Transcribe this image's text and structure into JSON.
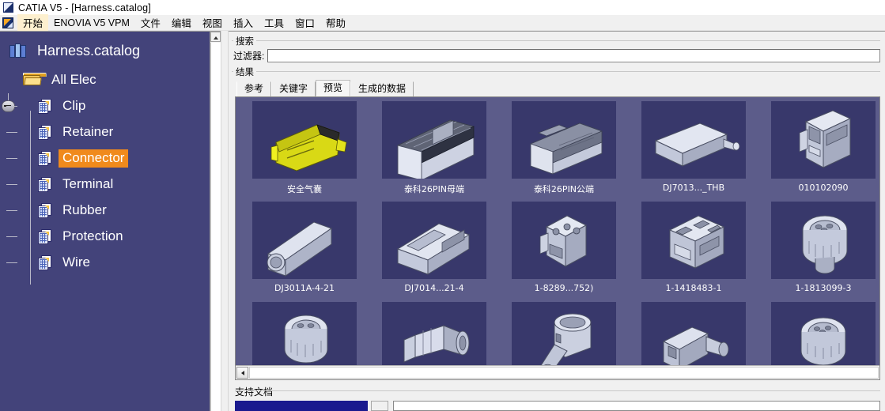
{
  "window": {
    "title": "CATIA V5 - [Harness.catalog]",
    "app_icon": "catia-logo-icon"
  },
  "menubar": {
    "start_icon": "catia-start-icon",
    "items": [
      {
        "label": "开始",
        "active": true
      },
      {
        "label": "ENOVIA V5 VPM",
        "active": false
      },
      {
        "label": "文件",
        "active": false
      },
      {
        "label": "编辑",
        "active": false
      },
      {
        "label": "视图",
        "active": false
      },
      {
        "label": "插入",
        "active": false
      },
      {
        "label": "工具",
        "active": false
      },
      {
        "label": "窗口",
        "active": false
      },
      {
        "label": "帮助",
        "active": false
      }
    ]
  },
  "tree": {
    "root": {
      "label": "Harness.catalog",
      "icon": "catalog-icon"
    },
    "folder": {
      "label": "All Elec",
      "icon": "folder-open-icon"
    },
    "children": [
      {
        "label": "Clip",
        "icon": "chapter-icon",
        "selected": false
      },
      {
        "label": "Retainer",
        "icon": "chapter-icon",
        "selected": false
      },
      {
        "label": "Connector",
        "icon": "chapter-icon",
        "selected": true
      },
      {
        "label": "Terminal",
        "icon": "chapter-icon",
        "selected": false
      },
      {
        "label": "Rubber",
        "icon": "chapter-icon",
        "selected": false
      },
      {
        "label": "Protection",
        "icon": "chapter-icon",
        "selected": false
      },
      {
        "label": "Wire",
        "icon": "chapter-icon",
        "selected": false
      }
    ],
    "selection_color": "#f08a1c",
    "background_color": "#43437a"
  },
  "search": {
    "legend": "搜索",
    "filter_label": "过滤器:",
    "filter_value": "",
    "filter_placeholder": ""
  },
  "results": {
    "legend": "结果",
    "tabs": [
      {
        "label": "参考",
        "active": false
      },
      {
        "label": "关键字",
        "active": false
      },
      {
        "label": "预览",
        "active": true
      },
      {
        "label": "生成的数据",
        "active": false
      }
    ]
  },
  "gallery": {
    "background_color": "#5c5c8a",
    "thumb_background": "#38386b",
    "items": [
      {
        "caption": "安全气囊",
        "shape": "airbag-connector",
        "color": "#d4d418"
      },
      {
        "caption": "泰科26PIN母端",
        "shape": "rect-connector-female",
        "color": "#c9cfe0"
      },
      {
        "caption": "泰科26PIN公端",
        "shape": "rect-connector-male",
        "color": "#b9bfd2"
      },
      {
        "caption": "DJ7013..._THB",
        "shape": "cylinder-pin",
        "color": "#c6ccdd"
      },
      {
        "caption": "010102090",
        "shape": "box-housing",
        "color": "#c3c9da"
      },
      {
        "caption": "DJ3011A-4-21",
        "shape": "tube-connector",
        "color": "#b6bdd1"
      },
      {
        "caption": "DJ7014...21-4",
        "shape": "slab-connector",
        "color": "#c0c6d8"
      },
      {
        "caption": "1-8289...752)",
        "shape": "block-connector",
        "color": "#b4bace"
      },
      {
        "caption": "1-1418483-1",
        "shape": "multi-port-connector",
        "color": "#bcc2d5"
      },
      {
        "caption": "1-1813099-3",
        "shape": "round-circular-connector",
        "color": "#c2c8da"
      },
      {
        "caption": "",
        "shape": "round-circular-connector",
        "color": "#c2c8da"
      },
      {
        "caption": "",
        "shape": "barrel-connector",
        "color": "#c2c8da"
      },
      {
        "caption": "",
        "shape": "elbow-connector",
        "color": "#c2c8da"
      },
      {
        "caption": "",
        "shape": "angled-connector",
        "color": "#c2c8da"
      },
      {
        "caption": "",
        "shape": "round-circular-connector",
        "color": "#c2c8da"
      }
    ]
  },
  "support": {
    "legend": "支持文档"
  },
  "scrollbars": {
    "tree_up_arrow": "scroll-up-arrow-icon",
    "gallery_left_arrow": "scroll-left-arrow-icon"
  }
}
